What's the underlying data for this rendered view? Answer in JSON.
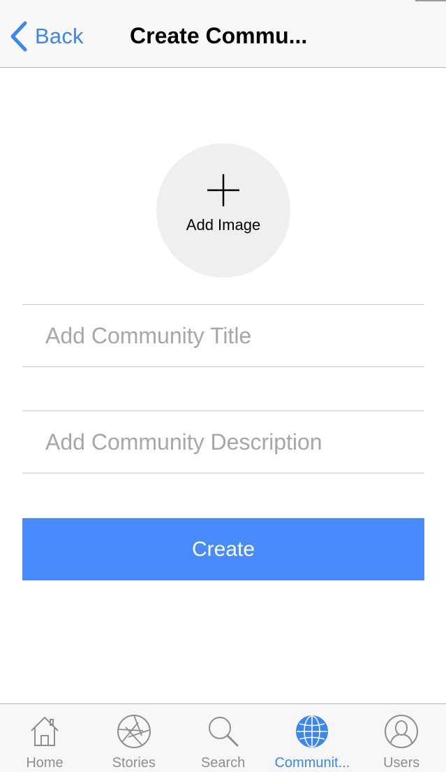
{
  "nav": {
    "back_label": "Back",
    "title": "Create Commu..."
  },
  "add_image": {
    "label": "Add Image"
  },
  "form": {
    "title_placeholder": "Add Community Title",
    "title_value": "",
    "description_placeholder": "Add Community Description",
    "description_value": "",
    "create_label": "Create"
  },
  "tabbar": {
    "active": "Communities",
    "tabs": [
      {
        "label": "Home",
        "icon": "home-icon"
      },
      {
        "label": "Stories",
        "icon": "aperture-icon"
      },
      {
        "label": "Search",
        "icon": "search-icon"
      },
      {
        "label": "Communit...",
        "icon": "globe-icon"
      },
      {
        "label": "Users",
        "icon": "user-icon"
      }
    ]
  },
  "colors": {
    "accent": "#3b86f5",
    "button": "#478bff",
    "placeholder": "#a7a7a9",
    "tab_inactive": "#8e8e93"
  }
}
